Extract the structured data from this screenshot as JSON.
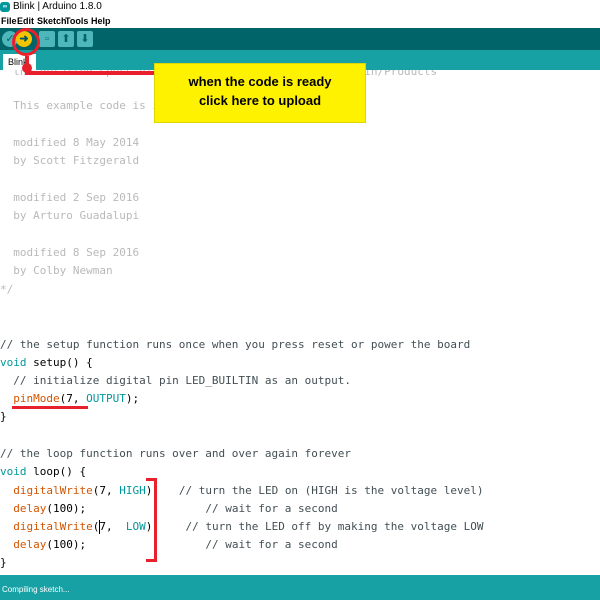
{
  "window": {
    "title": "Blink | Arduino 1.8.0",
    "logo_text": "∞"
  },
  "menu": [
    "File",
    "Edit",
    "Sketch",
    "Tools",
    "Help"
  ],
  "toolbar": {
    "upload_symbol": "➜"
  },
  "tab": {
    "label": "Blink"
  },
  "code_lines": {
    "l0": "  the detailed specs of ... http://www.arduino.cc/en/Main/Products",
    "l1": "  This example code is in the public domain.",
    "l2": "  modified 8 May 2014",
    "l3": "  by Scott Fitzgerald",
    "l4": "  modified 2 Sep 2016",
    "l5": "  by Arturo Guadalupi",
    "l6": "  modified 8 Sep 2016",
    "l7": "  by Colby Newman",
    "l8": "*/",
    "setup_comment": "// the setup function runs once when you press reset or power the board",
    "setup_kw": "void",
    "setup_rest": " setup() {",
    "init_comment": "  // initialize digital pin LED_BUILTIN as an output.",
    "pinmode_fn": "pinMode",
    "pinmode_args1": "(7, ",
    "pinmode_const": "OUTPUT",
    "pinmode_args2": ");",
    "close_brace": "}",
    "loop_comment": "// the loop function runs over and over again forever",
    "loop_kw": "void",
    "loop_rest": " loop() {",
    "dw_fn": "digitalWrite",
    "dw1_args1": "(7, ",
    "dw1_const": "HIGH",
    "dw1_args2": ");",
    "dw1_comment": "   // turn the LED on (HIGH is the voltage level)",
    "delay_fn": "delay",
    "delay_args": "(100);",
    "delay_comment": "                  // wait for a second",
    "dw2_args1": "(7,  ",
    "dw2_const": "LOW",
    "dw2_args2": ");",
    "dw2_comment": "    // turn the LED off by making the voltage LOW"
  },
  "callout": {
    "line1": "when the code is ready",
    "line2": "click here to upload"
  },
  "status": {
    "text": "Compiling sketch..."
  },
  "colors": {
    "toolbar": "#006468",
    "tabbar": "#17a1a5",
    "upload": "#f4c400",
    "annotation": "#e8202c",
    "callout": "#fff200"
  }
}
